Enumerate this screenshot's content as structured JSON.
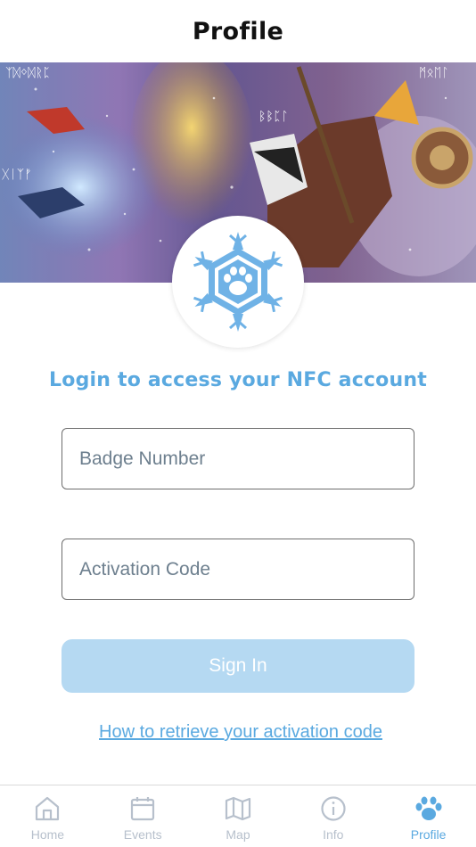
{
  "header": {
    "title": "Profile"
  },
  "banner": {
    "runes_top_left": "ᛉᛞᛜᛞᚱᛈ",
    "runes_top_right": "ᛗᛟᛖᛚ",
    "runes_center": "ᛒᛒᛈᛚ",
    "runes_left": "ᚷᛁᛉᚠ"
  },
  "login": {
    "heading": "Login to access your NFC account",
    "badge_placeholder": "Badge Number",
    "activation_placeholder": "Activation Code",
    "signin_label": "Sign In",
    "help_link": "How to retrieve your activation code"
  },
  "tabs": [
    {
      "label": "Home",
      "icon": "home-icon",
      "active": false
    },
    {
      "label": "Events",
      "icon": "calendar-icon",
      "active": false
    },
    {
      "label": "Map",
      "icon": "map-icon",
      "active": false
    },
    {
      "label": "Info",
      "icon": "info-icon",
      "active": false
    },
    {
      "label": "Profile",
      "icon": "paw-icon",
      "active": true
    }
  ],
  "colors": {
    "accent": "#5aa9e0",
    "button_disabled": "#b5d9f2",
    "tab_inactive": "#b7c0cc"
  }
}
